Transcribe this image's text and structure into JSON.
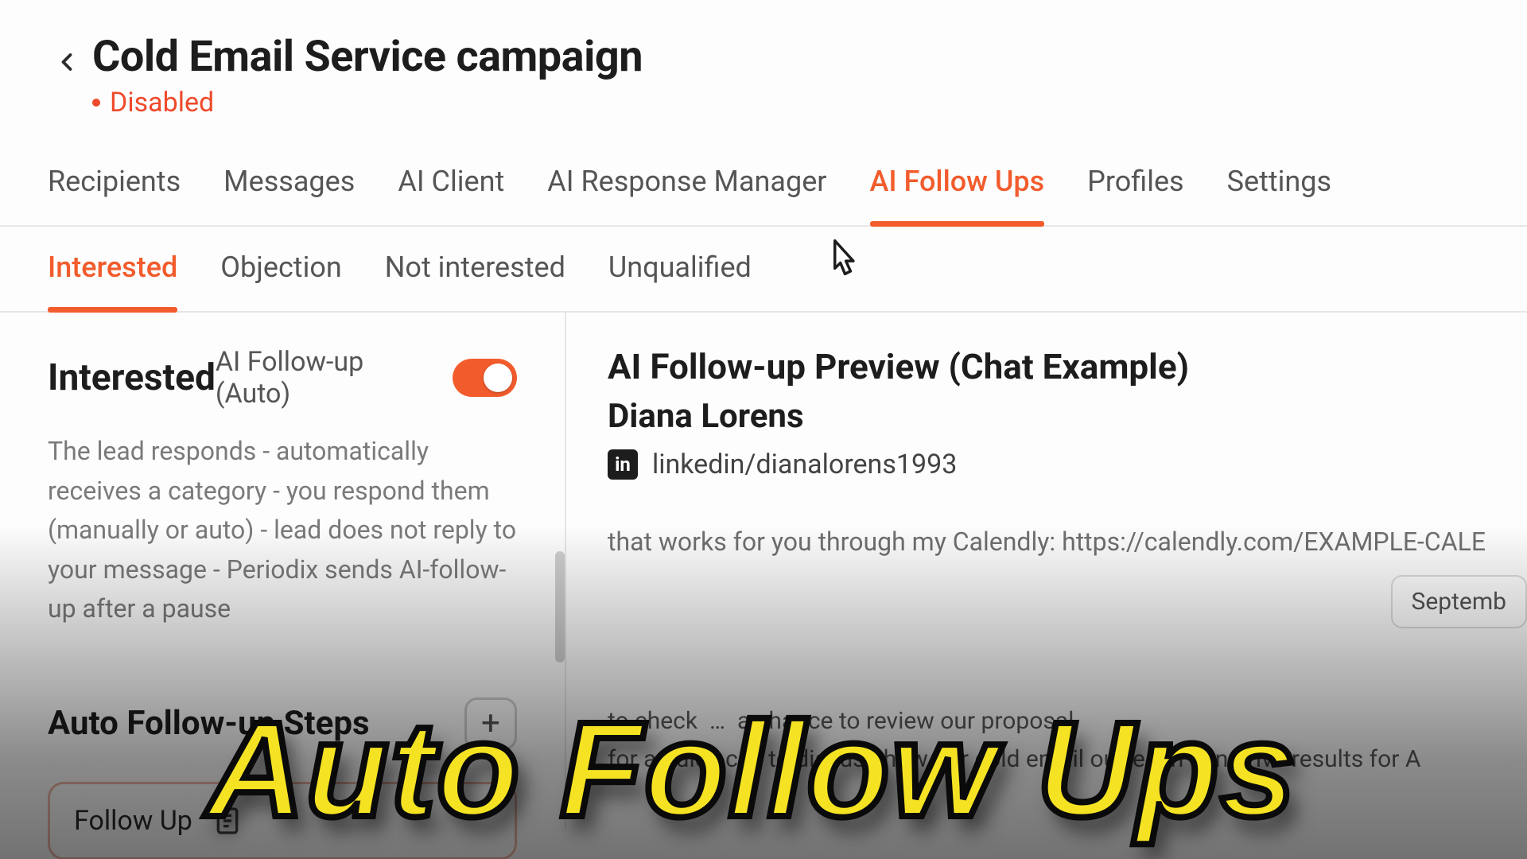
{
  "header": {
    "title": "Cold Email Service campaign",
    "status": "Disabled"
  },
  "nav": {
    "items": [
      {
        "label": "Recipients"
      },
      {
        "label": "Messages"
      },
      {
        "label": "AI Client"
      },
      {
        "label": "AI Response Manager"
      },
      {
        "label": "AI Follow Ups",
        "active": true
      },
      {
        "label": "Profiles"
      },
      {
        "label": "Settings"
      }
    ]
  },
  "subnav": {
    "items": [
      {
        "label": "Interested",
        "active": true
      },
      {
        "label": "Objection"
      },
      {
        "label": "Not interested"
      },
      {
        "label": "Unqualified"
      }
    ]
  },
  "left": {
    "category_title": "Interested",
    "toggle_label": "AI Follow-up (Auto)",
    "toggle_on": true,
    "description": "The lead responds - automatically receives a category - you respond them (manually or auto) - lead does not reply to your message - Periodix sends AI-follow-up after a pause",
    "steps_title": "Auto Follow-up Steps",
    "add_label": "+",
    "step1_label": "Follow Up"
  },
  "right": {
    "preview_title": "AI Follow-up Preview (Chat Example)",
    "person_name": "Diana Lorens",
    "linkedin_badge": "in",
    "linkedin_handle": "linkedin/dianalorens1993",
    "message_line": "that works for you through my Calendly: https://calendly.com/EXAMPLE-CALE",
    "date_chip": "Septemb",
    "reply_line1": "to check",
    "reply_line1_suffix": "a chance to review our proposal",
    "reply_line2": "for a quick call to discuss how our cold email outreach can drive results for A"
  },
  "overlay": {
    "caption": "Auto Follow Ups"
  },
  "colors": {
    "accent": "#f25c2d",
    "caption_fill": "#f5e323"
  }
}
